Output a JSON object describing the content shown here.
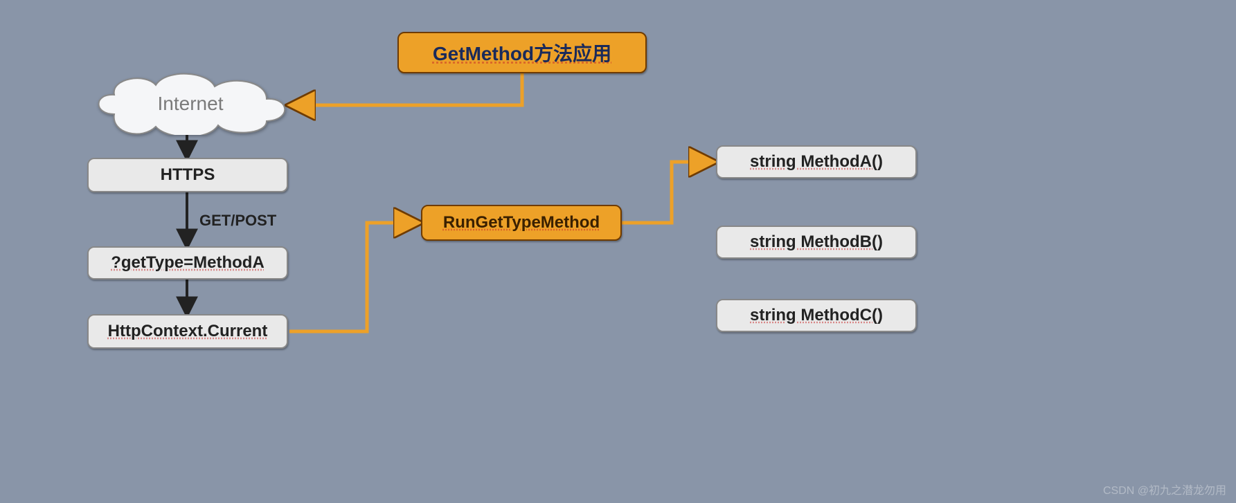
{
  "chart_data": {
    "type": "flow-diagram",
    "nodes": [
      {
        "id": "title",
        "label": "GetMethod方法应用",
        "kind": "orange"
      },
      {
        "id": "internet",
        "label": "Internet",
        "kind": "cloud"
      },
      {
        "id": "https",
        "label": "HTTPS",
        "kind": "grey"
      },
      {
        "id": "gettype",
        "label": "?getType=MethodA",
        "kind": "grey"
      },
      {
        "id": "httpctx",
        "label": "HttpContext.Current",
        "kind": "grey"
      },
      {
        "id": "run",
        "label": "RunGetTypeMethod",
        "kind": "orange"
      },
      {
        "id": "ma",
        "label": "string MethodA()",
        "kind": "grey"
      },
      {
        "id": "mb",
        "label": "string MethodB()",
        "kind": "grey"
      },
      {
        "id": "mc",
        "label": "string MethodC()",
        "kind": "grey"
      }
    ],
    "edges": [
      {
        "from": "title",
        "to": "internet",
        "style": "orange-elbow"
      },
      {
        "from": "internet",
        "to": "https",
        "style": "black-arrow"
      },
      {
        "from": "https",
        "to": "gettype",
        "style": "black-arrow",
        "label": "GET/POST"
      },
      {
        "from": "gettype",
        "to": "httpctx",
        "style": "black-arrow"
      },
      {
        "from": "httpctx",
        "to": "run",
        "style": "orange-elbow"
      },
      {
        "from": "run",
        "to": "ma",
        "style": "orange-elbow"
      }
    ]
  },
  "title": "GetMethod方法应用",
  "internet": "Internet",
  "https": "HTTPS",
  "gettype": "?getType=MethodA",
  "httpctx": "HttpContext.Current",
  "run": "RunGetTypeMethod",
  "ma": "string MethodA()",
  "mb": "string MethodB()",
  "mc": "string MethodC()",
  "edge_getpost": "GET/POST",
  "watermark": "CSDN @初九之潜龙勿用"
}
